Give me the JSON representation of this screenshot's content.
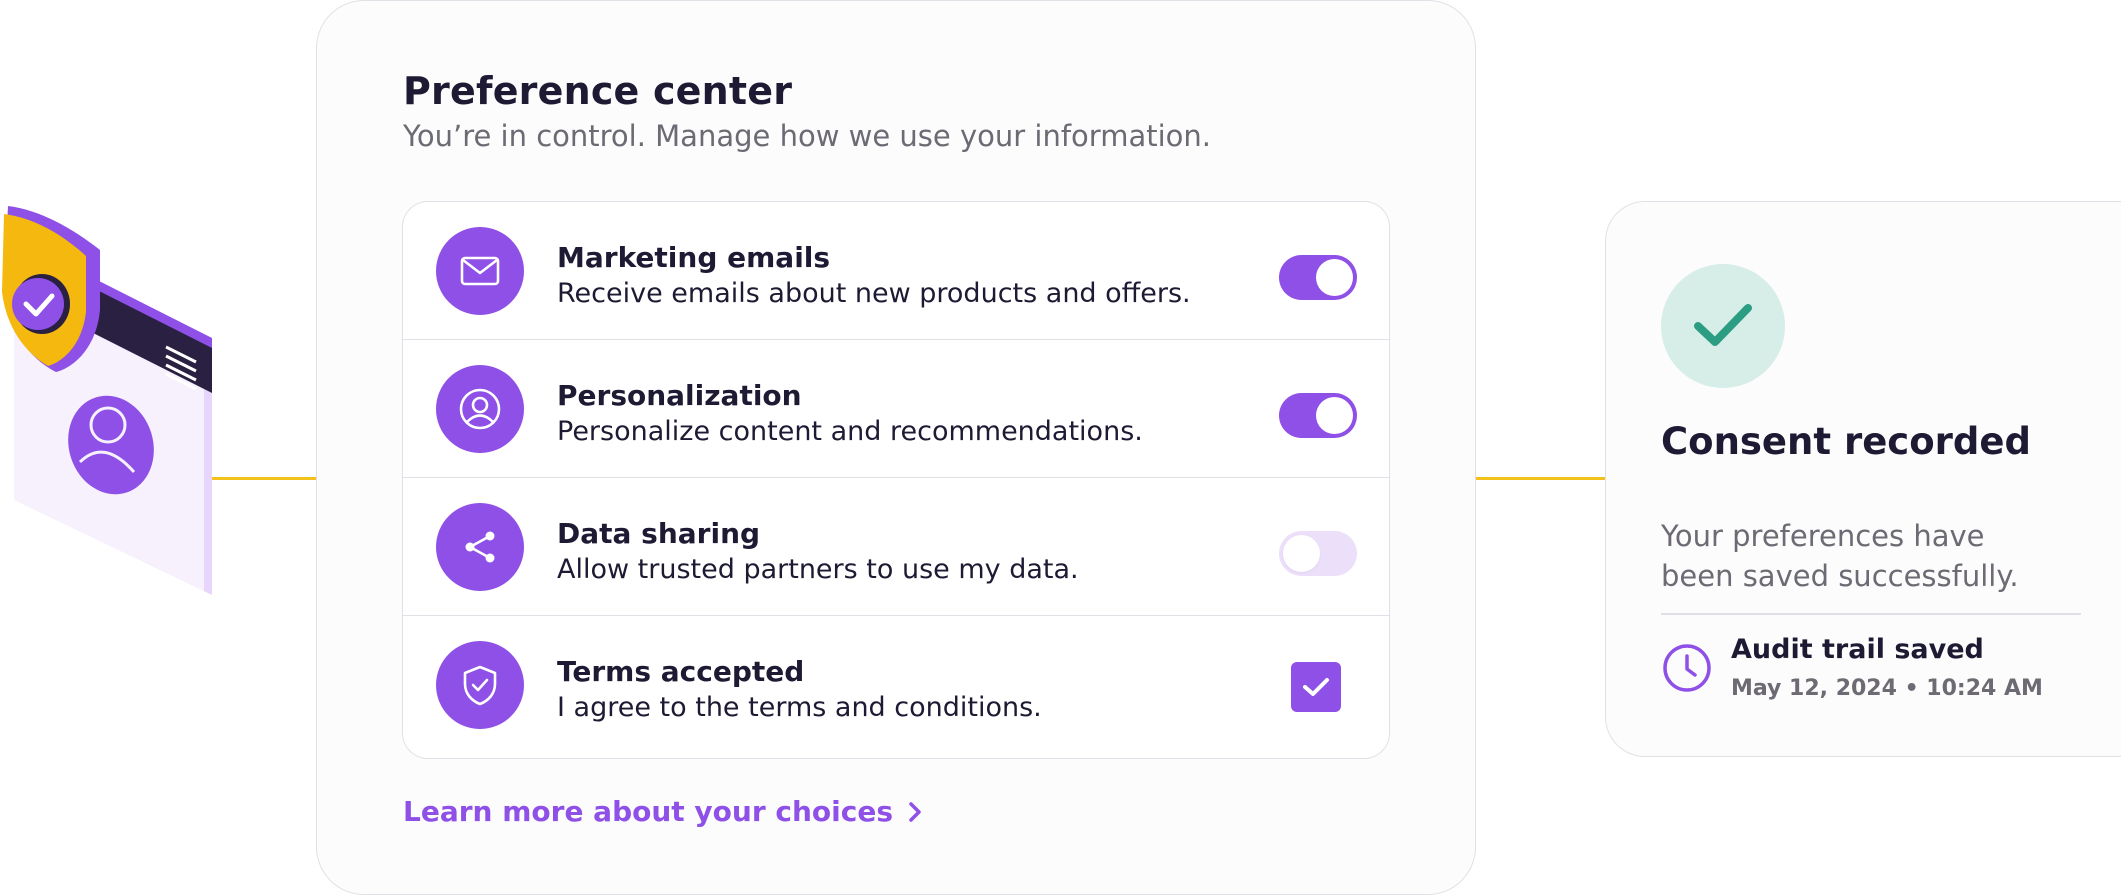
{
  "colors": {
    "accent": "#8e50e6",
    "accent_light": "#ecdffa",
    "connector": "#f2c21b",
    "success_bg": "#d6ede8",
    "success_check": "#2a9d82",
    "text_primary": "#1f1a33",
    "text_secondary": "#6d6a74",
    "border": "#e2e0e6"
  },
  "illustration": {
    "icons": [
      "shield-check-icon",
      "browser-window-icon",
      "user-profile-icon",
      "menu-lines-icon"
    ]
  },
  "panel": {
    "title": "Preference center",
    "subtitle": "You’re in control. Manage how we use your information.",
    "preferences": [
      {
        "label": "Marketing emails",
        "description": "Receive emails about new products and offers.",
        "icon": "envelope-icon",
        "control": "toggle",
        "enabled": true
      },
      {
        "label": "Personalization",
        "description": "Personalize content and recommendations.",
        "icon": "user-circle-icon",
        "control": "toggle",
        "enabled": true
      },
      {
        "label": "Data sharing",
        "description": "Allow trusted partners to use my data.",
        "icon": "share-icon",
        "control": "toggle",
        "enabled": false
      },
      {
        "label": "Terms accepted",
        "description": "I agree to the terms and conditions.",
        "icon": "shield-check-icon",
        "control": "checkbox",
        "enabled": true
      }
    ],
    "learn_more": {
      "label": "Learn more about your choices",
      "icon": "chevron-right-icon"
    }
  },
  "consent": {
    "title": "Consent recorded",
    "message": "Your preferences have been saved successfully.",
    "audit_title": "Audit trail saved",
    "audit_timestamp": "May 12, 2024 • 10:24 AM",
    "icons": {
      "status": "checkmark-icon",
      "audit": "clock-icon"
    }
  }
}
